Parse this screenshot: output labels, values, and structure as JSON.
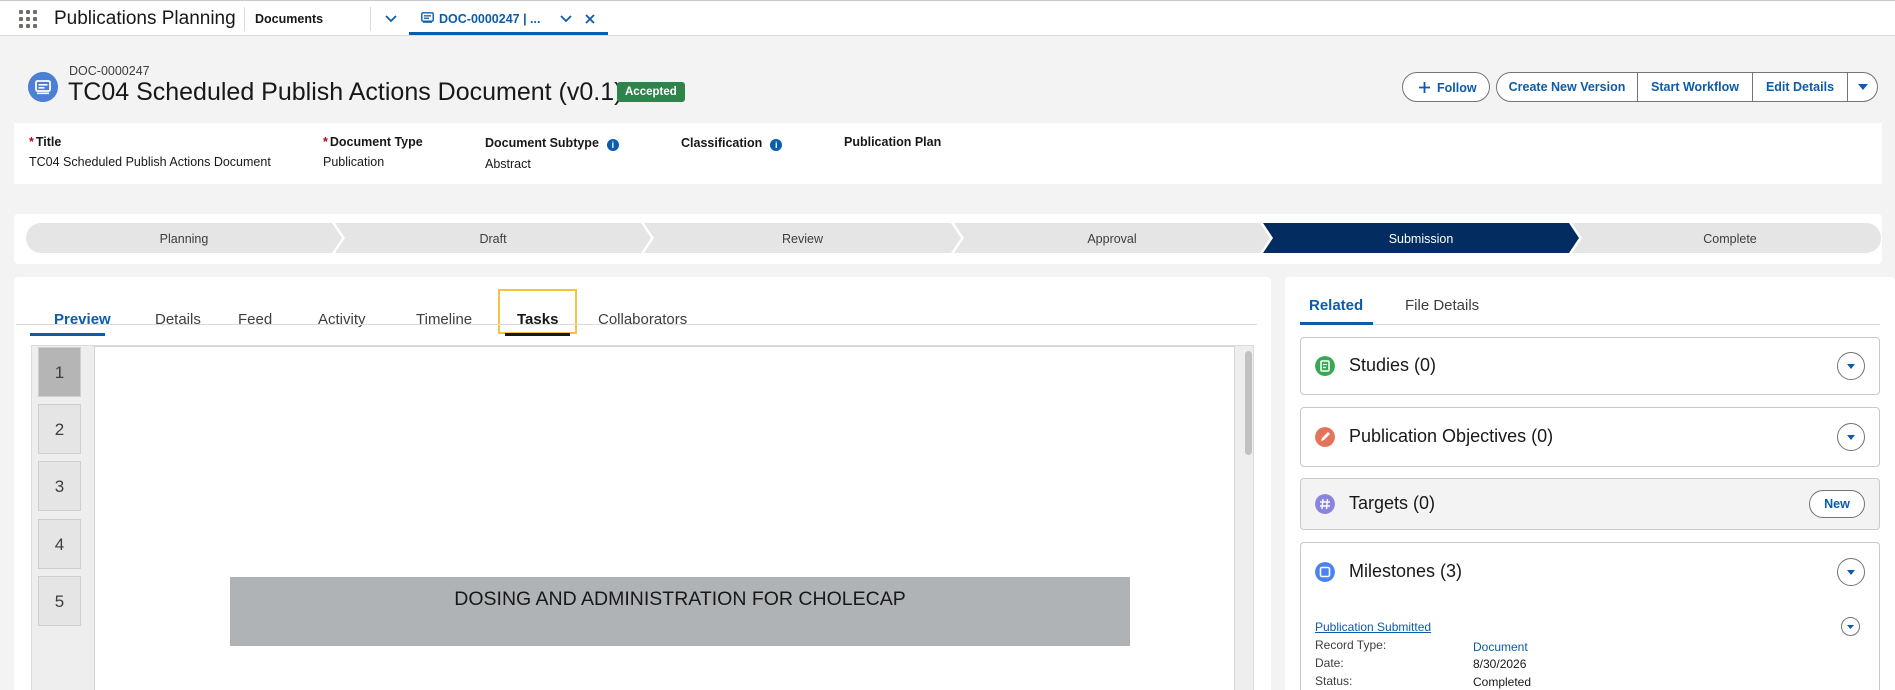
{
  "topnav": {
    "app_name": "Publications Planning",
    "nav_label": "Documents",
    "active_tab_label": "DOC-0000247 | ..."
  },
  "header": {
    "record_id": "DOC-0000247",
    "title": "TC04 Scheduled Publish Actions Document (v0.1)",
    "status_badge": "Accepted",
    "actions": {
      "follow": "Follow",
      "create_new_version": "Create New Version",
      "start_workflow": "Start Workflow",
      "edit_details": "Edit Details"
    }
  },
  "highlights": {
    "fields": [
      {
        "label": "Title",
        "required": true,
        "value": "TC04 Scheduled Publish Actions Document",
        "info": false
      },
      {
        "label": "Document Type",
        "required": true,
        "value": "Publication",
        "info": false
      },
      {
        "label": "Document Subtype",
        "required": false,
        "value": "Abstract",
        "info": true
      },
      {
        "label": "Classification",
        "required": false,
        "value": "",
        "info": true
      },
      {
        "label": "Publication Plan",
        "required": false,
        "value": "",
        "info": false
      }
    ]
  },
  "path": {
    "stages": [
      "Planning",
      "Draft",
      "Review",
      "Approval",
      "Submission",
      "Complete"
    ],
    "current_index": 4,
    "colors": {
      "current": "#032d60",
      "default": "#e5e5e5"
    }
  },
  "main_tabs": {
    "items": [
      "Preview",
      "Details",
      "Feed",
      "Activity",
      "Timeline",
      "Tasks",
      "Collaborators"
    ],
    "selected": "Preview",
    "focused": "Tasks"
  },
  "viewer": {
    "pages": [
      "1",
      "2",
      "3",
      "4",
      "5"
    ],
    "active_page": "1",
    "banner_text": "DOSING AND ADMINISTRATION FOR CHOLECAP"
  },
  "side_tabs": {
    "items": [
      "Related",
      "File Details"
    ],
    "selected": "Related"
  },
  "related": {
    "lists": [
      {
        "title": "Studies (0)",
        "icon": "study-icon",
        "color": "#3ba755",
        "action": "menu"
      },
      {
        "title": "Publication Objectives (0)",
        "icon": "objective-icon",
        "color": "#e3735a",
        "action": "menu"
      },
      {
        "title": "Targets (0)",
        "icon": "target-icon",
        "color": "#8a84e0",
        "action": "new",
        "action_label": "New"
      },
      {
        "title": "Milestones (3)",
        "icon": "milestone-icon",
        "color": "#4a82f0",
        "action": "menu"
      }
    ],
    "milestone_item": {
      "name": "Publication Submitted",
      "fields": [
        {
          "label": "Record Type:",
          "value": "Document",
          "link": true
        },
        {
          "label": "Date:",
          "value": "8/30/2026",
          "link": false
        },
        {
          "label": "Status:",
          "value": "Completed",
          "link": false
        }
      ]
    }
  },
  "accent_color": "#0b5cab"
}
